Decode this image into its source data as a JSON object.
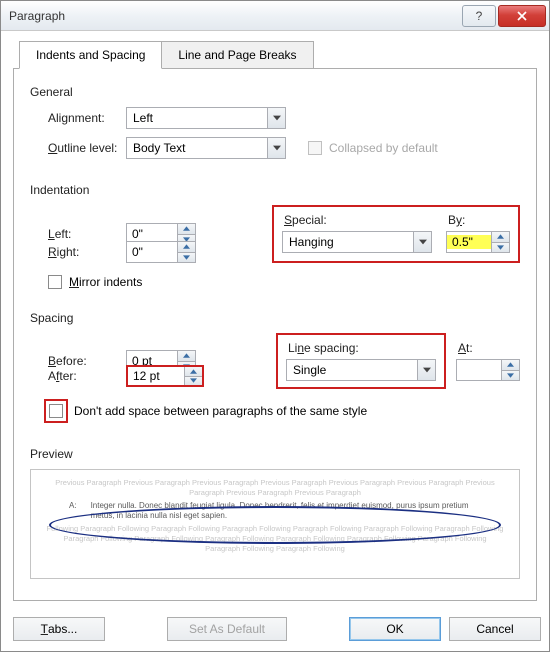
{
  "title": "Paragraph",
  "tabs": {
    "t0": "Indents and Spacing",
    "t1": "Line and Page Breaks"
  },
  "general": {
    "label": "General",
    "alignment_label": "Alignment:",
    "alignment_value": "Left",
    "outline_label": "Outline level:",
    "outline_value": "Body Text",
    "collapsed_label": "Collapsed by default"
  },
  "indentation": {
    "label": "Indentation",
    "left_label": "Left:",
    "left_value": "0\"",
    "right_label": "Right:",
    "right_value": "0\"",
    "mirror_label": "Mirror indents",
    "special_label": "Special:",
    "special_value": "Hanging",
    "by_label": "By:",
    "by_value": "0.5\""
  },
  "spacing": {
    "label": "Spacing",
    "before_label": "Before:",
    "before_value": "0 pt",
    "after_label": "After:",
    "after_value": "12 pt",
    "line_label": "Line spacing:",
    "line_value": "Single",
    "at_label": "At:",
    "at_value": "",
    "noaddspace_label": "Don't add space between paragraphs of the same style"
  },
  "preview": {
    "label": "Preview",
    "filler_prev": "Previous Paragraph Previous Paragraph Previous Paragraph Previous Paragraph Previous Paragraph Previous Paragraph Previous Paragraph Previous Paragraph Previous Paragraph",
    "sample_key": "A:",
    "sample_text": "Integer nulla. Donec blandit feugiat ligula. Donec hendrerit, felis et imperdiet euismod, purus ipsum pretium metus, in lacinia nulla nisl eget sapien.",
    "filler_foll": "Following Paragraph Following Paragraph Following Paragraph Following Paragraph Following Paragraph Following Paragraph Following Paragraph Following Paragraph Following Paragraph Following Paragraph Following Paragraph Following Paragraph Following Paragraph Following Paragraph Following"
  },
  "buttons": {
    "tabs": "Tabs...",
    "setdefault": "Set As Default",
    "ok": "OK",
    "cancel": "Cancel"
  }
}
